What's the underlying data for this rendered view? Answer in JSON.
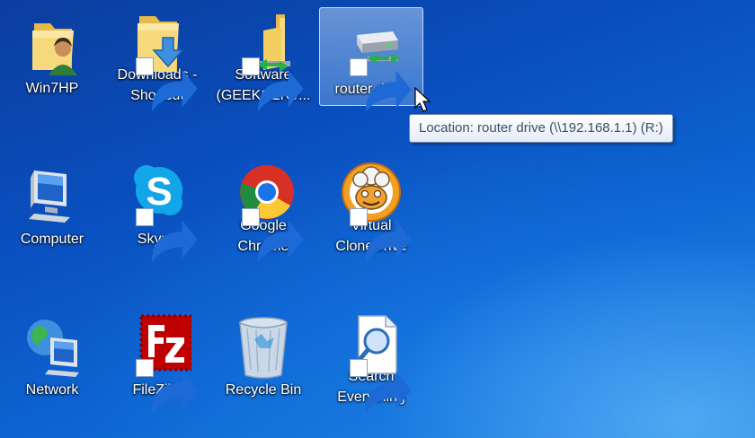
{
  "desktop": {
    "icons": [
      {
        "label": "Win7HP",
        "icon": "user-folder-icon",
        "shortcut": false
      },
      {
        "label": "Downloads -\nShortcut",
        "icon": "downloads-folder-icon",
        "shortcut": true
      },
      {
        "label": "Software\n(GEEKSERV...",
        "icon": "network-folder-icon",
        "shortcut": true
      },
      {
        "label": "router drive",
        "icon": "network-drive-icon",
        "shortcut": true,
        "selected": true
      },
      {
        "label": "Computer",
        "icon": "computer-icon",
        "shortcut": false
      },
      {
        "label": "Skype",
        "icon": "skype-icon",
        "shortcut": true
      },
      {
        "label": "Google\nChrome",
        "icon": "chrome-icon",
        "shortcut": true
      },
      {
        "label": "Virtual\nCloneDrive",
        "icon": "virtual-clonedrive-icon",
        "shortcut": true
      },
      {
        "label": "Network",
        "icon": "network-icon",
        "shortcut": false
      },
      {
        "label": "FileZilla",
        "icon": "filezilla-icon",
        "shortcut": true
      },
      {
        "label": "Recycle Bin",
        "icon": "recycle-bin-icon",
        "shortcut": false
      },
      {
        "label": "Search\nEverything",
        "icon": "search-everything-icon",
        "shortcut": true
      }
    ]
  },
  "tooltip": {
    "text": "Location: router drive (\\\\192.168.1.1) (R:)"
  },
  "colors": {
    "desktop_top": "#0b3e9e",
    "desktop_glow": "#78c8ff",
    "selection": "#b4d2f5",
    "folder_yellow": "#f0d070"
  }
}
